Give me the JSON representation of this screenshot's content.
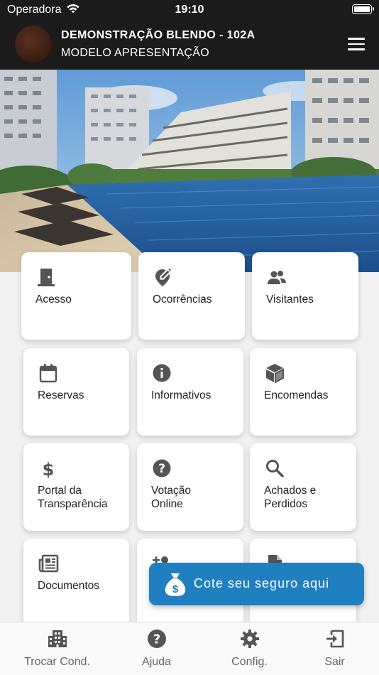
{
  "status_bar": {
    "carrier": "Operadora",
    "time": "19:10"
  },
  "header": {
    "title": "DEMONSTRAÇÃO BLENDO - 102A",
    "subtitle": "MODELO APRESENTAÇÃO",
    "menu_icon": "hamburger-menu-icon"
  },
  "grid": {
    "items": [
      {
        "label": "Acesso",
        "icon": "door-icon"
      },
      {
        "label": "Ocorrências",
        "icon": "edit-location-icon"
      },
      {
        "label": "Visitantes",
        "icon": "people-icon"
      },
      {
        "label": "Reservas",
        "icon": "calendar-icon"
      },
      {
        "label": "Informativos",
        "icon": "info-icon"
      },
      {
        "label": "Encomendas",
        "icon": "package-icon"
      },
      {
        "label": "Portal da\nTransparência",
        "icon": "dollar-icon"
      },
      {
        "label": "Votação\nOnline",
        "icon": "help-circle-icon"
      },
      {
        "label": "Achados e\nPerdidos",
        "icon": "search-icon"
      },
      {
        "label": "Documentos",
        "icon": "newspaper-icon"
      },
      {
        "label": "",
        "icon": "add-person-icon"
      },
      {
        "label": "",
        "icon": "document-icon"
      }
    ]
  },
  "fab": {
    "label": "Cote seu seguro aqui",
    "icon": "money-bag-icon"
  },
  "tabbar": {
    "tabs": [
      {
        "label": "Trocar Cond.",
        "icon": "building-icon"
      },
      {
        "label": "Ajuda",
        "icon": "help-icon"
      },
      {
        "label": "Config.",
        "icon": "gear-icon"
      },
      {
        "label": "Sair",
        "icon": "exit-icon"
      }
    ]
  },
  "colors": {
    "header_bg": "#1b1b1b",
    "fab_bg": "#1f7fc1",
    "icon_gray": "#555555"
  }
}
